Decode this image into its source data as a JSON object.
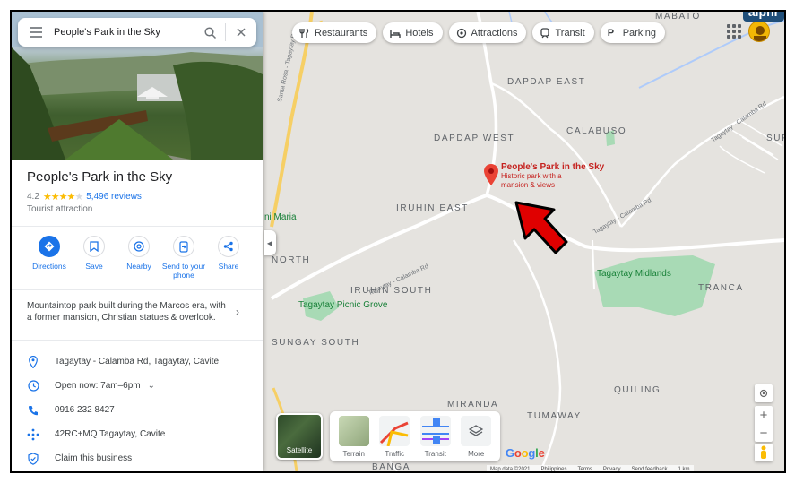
{
  "search": {
    "query": "People's Park in the Sky"
  },
  "place": {
    "name": "People's Park in the Sky",
    "rating": "4.2",
    "stars_filled": 4,
    "reviews": "5,496 reviews",
    "category": "Tourist attraction",
    "description": "Mountaintop park built during the Marcos era, with a former mansion, Christian statues & overlook."
  },
  "actions": [
    {
      "label": "Directions",
      "icon": "directions-icon"
    },
    {
      "label": "Save",
      "icon": "bookmark-icon"
    },
    {
      "label": "Nearby",
      "icon": "nearby-icon"
    },
    {
      "label": "Send to your phone",
      "icon": "send-to-phone-icon"
    },
    {
      "label": "Share",
      "icon": "share-icon"
    }
  ],
  "info": {
    "address": "Tagaytay - Calamba Rd, Tagaytay, Cavite",
    "hours": "Open now:  7am–6pm",
    "phone": "0916 232 8427",
    "plus_code": "42RC+MQ Tagaytay, Cavite",
    "claim": "Claim this business"
  },
  "chips": [
    "Restaurants",
    "Hotels",
    "Attractions",
    "Transit",
    "Parking"
  ],
  "map": {
    "pin_title": "People's Park in the Sky",
    "pin_subtitle": "Historic park with a mansion & views",
    "places": {
      "mabato": "MABATO",
      "dapdap_east": "DAPDAP EAST",
      "dapdap_west": "DAPDAP WEST",
      "calabuso": "CALABUSO",
      "iruhin_east": "IRUHIN EAST",
      "iruhin_south": "IRUHIN SOUTH",
      "north": "NORTH",
      "sungay_south": "SUNGAY SOUTH",
      "tranca": "TRANCA",
      "quiling": "QUILING",
      "miranda": "MIRANDA",
      "tumaway": "TUMAWAY",
      "banga": "BANGA",
      "nimaria": "ni Maria",
      "sup": "SUP"
    },
    "green_places": {
      "midlands": "Tagaytay Midlands",
      "picnic": "Tagaytay Picnic Grove"
    },
    "roads": {
      "santa_rosa": "Santa Rosa - Tagaytay Rd",
      "tagaytay_calamba": "Tagaytay - Calamba Rd",
      "calamba_rd_2": "Tagaytay - Calamba Rd",
      "calamba_rd_3": "Tagaytay - Calamba Rd"
    },
    "layers": [
      "Satellite",
      "Terrain",
      "Traffic",
      "Transit",
      "More"
    ],
    "google": "Google",
    "attribution": [
      "Map data ©2021",
      "Philippines",
      "Terms",
      "Privacy",
      "Send feedback",
      "1 km"
    ],
    "watermark": "alphr"
  },
  "colors": {
    "accent": "#1a73e8",
    "pin": "#ea4335",
    "star": "#fbbc04",
    "arrow": "#e00000",
    "park_green": "#a8dab5"
  }
}
